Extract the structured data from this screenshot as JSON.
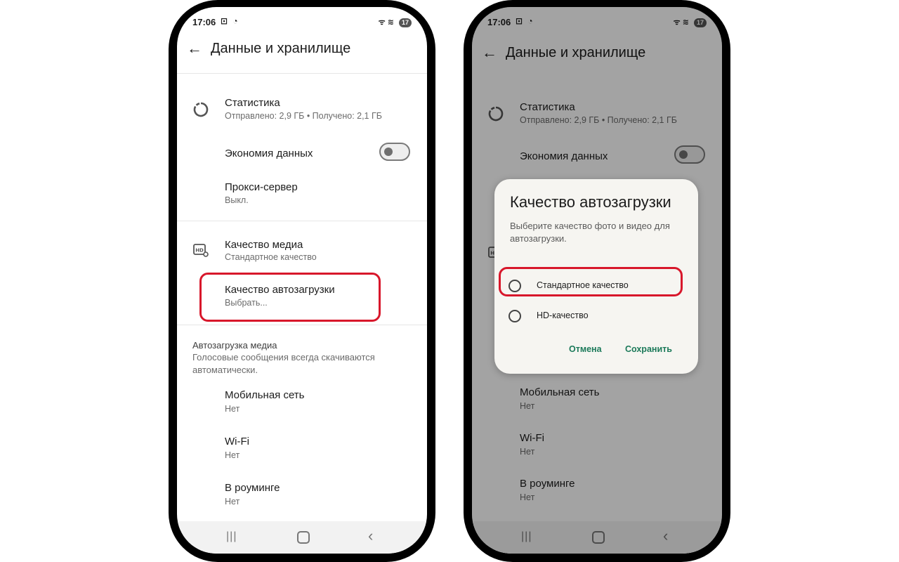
{
  "status_bar": {
    "time": "17:06",
    "left_icons": "⊡ ◔",
    "signal": "ᯤ ≋",
    "battery": "17"
  },
  "app_bar": {
    "back_icon": "arrow-left-icon",
    "title": "Данные и хранилище"
  },
  "settings": {
    "statistics": {
      "title": "Статистика",
      "subtitle": "Отправлено: 2,9 ГБ • Получено: 2,1 ГБ"
    },
    "data_saver": {
      "title": "Экономия данных",
      "enabled": false
    },
    "proxy": {
      "title": "Прокси-сервер",
      "subtitle": "Выкл."
    },
    "media_quality": {
      "title": "Качество медиа",
      "subtitle": "Стандартное качество"
    },
    "upload_quality": {
      "title": "Качество автозагрузки",
      "subtitle": "Выбрать..."
    },
    "media_autodownload": {
      "header": "Автозагрузка медиа",
      "description": "Голосовые сообщения всегда скачиваются автоматически."
    },
    "mobile": {
      "title": "Мобильная сеть",
      "subtitle": "Нет"
    },
    "wifi": {
      "title": "Wi-Fi",
      "subtitle": "Нет"
    },
    "roaming": {
      "title": "В роуминге",
      "subtitle": "Нет"
    }
  },
  "dialog": {
    "title": "Качество автозагрузки",
    "description": "Выберите качество фото и видео для автозагрузки.",
    "options": [
      "Стандартное качество",
      "HD-качество"
    ],
    "cancel": "Отмена",
    "save": "Сохранить"
  },
  "colors": {
    "highlight": "#d8172b",
    "accent": "#1c7a5a"
  }
}
